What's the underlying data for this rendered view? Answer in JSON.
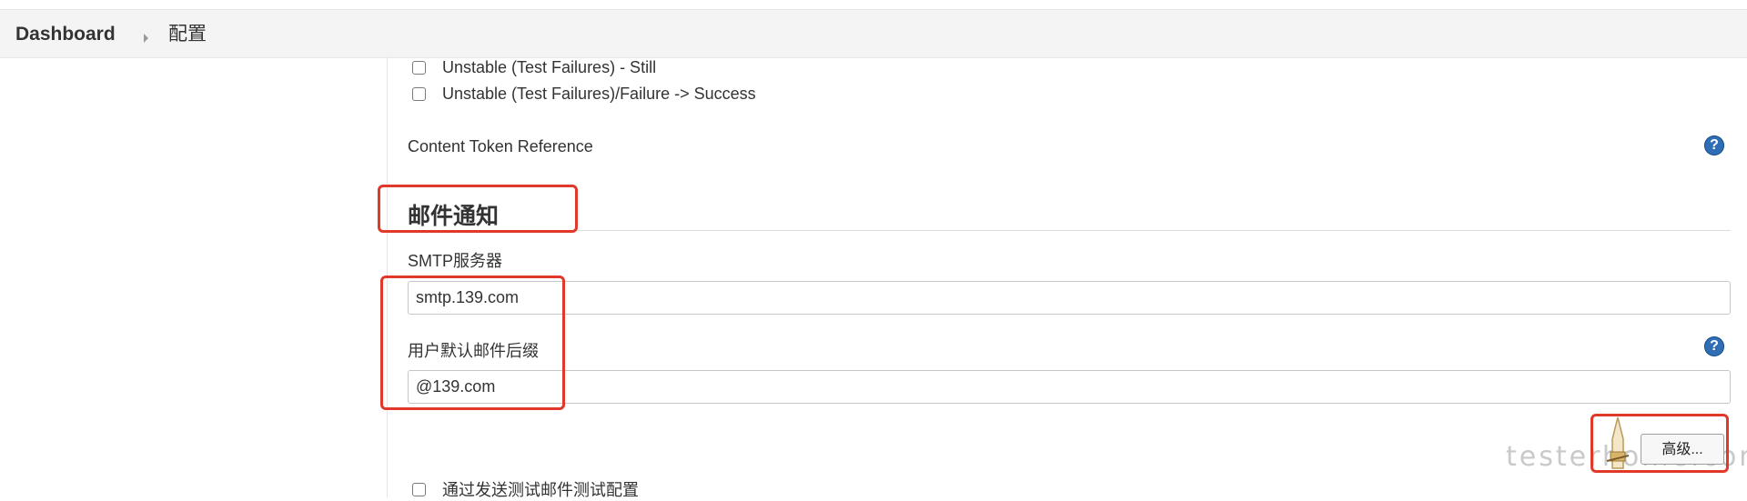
{
  "breadcrumb": {
    "home": "Dashboard",
    "current": "配置"
  },
  "triggers": [
    {
      "label": "Unstable (Test Failures) - Still",
      "checked": false
    },
    {
      "label": "Unstable (Test Failures)/Failure -> Success",
      "checked": false
    }
  ],
  "content_token": {
    "label": "Content Token Reference",
    "help": "?"
  },
  "email_section": {
    "title": "邮件通知",
    "smtp_label": "SMTP服务器",
    "smtp_value": "smtp.139.com",
    "suffix_label": "用户默认邮件后缀",
    "suffix_value": "@139.com",
    "suffix_help": "?",
    "advanced_button": "高级...",
    "test_config_label": "通过发送测试邮件测试配置",
    "test_config_checked": false
  },
  "watermark": "testerhome.com",
  "colors": {
    "highlight": "#e0392a",
    "help_icon": "#2f6db5",
    "breadcrumb_bg": "#f4f4f4"
  },
  "icons": {
    "help": "help-icon",
    "breadcrumb_separator": "chevron-right-icon"
  }
}
